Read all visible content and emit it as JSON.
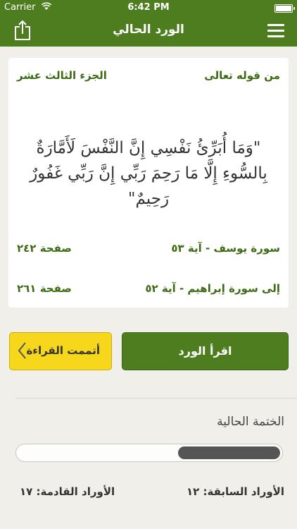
{
  "status_bar": {
    "carrier": "Carrier",
    "time": "6:42 PM"
  },
  "nav": {
    "title": "الورد الحالي",
    "share_icon": "share-icon",
    "menu_icon": "menu-icon"
  },
  "card": {
    "from_label": "من قوله تعالى",
    "juz": "الجزء الثالث عشر",
    "verse": "\"وَمَا أُبَرِّئُ نَفْسِي إِنَّ النَّفْسَ لَأَمَّارَةٌ بِالسُّوءِ إِلَّا مَا رَحِمَ رَبِّي إِنَّ رَبِّي غَفُورٌ رَحِيمٌ\"",
    "surah_from": "سورة يوسف - آية ٥٣",
    "page_from": "صفحة ٢٤٢",
    "surah_to": "إلى سورة إبراهيم - آية ٥٢",
    "page_to": "صفحة ٢٦١"
  },
  "buttons": {
    "done_label": "أتممت القراءة",
    "read_label": "اقرأ الورد"
  },
  "khatma": {
    "title": "الختمة الحالية",
    "progress": 0.39,
    "prev_label": "الأوراد السابقة:  ١٢",
    "next_label": "الأوراد القادمة: ١٧"
  },
  "colors": {
    "brand_green": "#4e7d1f",
    "accent_yellow": "#f6d71c",
    "progress_fill": "#555555"
  }
}
